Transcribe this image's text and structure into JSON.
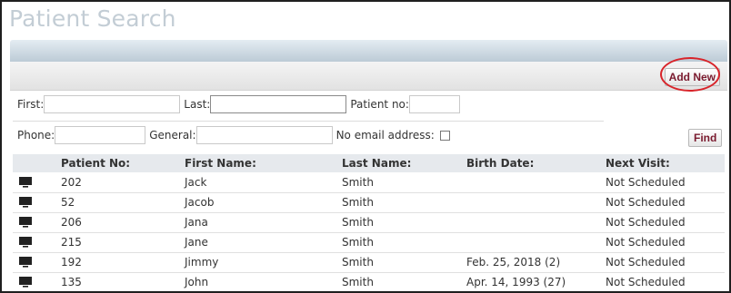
{
  "page": {
    "title": "Patient Search"
  },
  "toolbar": {
    "add_new_label": "Add New",
    "find_label": "Find"
  },
  "filters": {
    "first_label": "First:",
    "last_label": "Last:",
    "patient_no_label": "Patient no:",
    "phone_label": "Phone:",
    "general_label": "General:",
    "no_email_label": "No email address:"
  },
  "table": {
    "headers": [
      "Patient No:",
      "First Name:",
      "Last Name:",
      "Birth Date:",
      "Next Visit:"
    ],
    "rows": [
      {
        "patient_no": "202",
        "first": "Jack",
        "last": "Smith",
        "birth": "",
        "next_visit": "Not Scheduled"
      },
      {
        "patient_no": "52",
        "first": "Jacob",
        "last": "Smith",
        "birth": "",
        "next_visit": "Not Scheduled"
      },
      {
        "patient_no": "206",
        "first": "Jana",
        "last": "Smith",
        "birth": "",
        "next_visit": "Not Scheduled"
      },
      {
        "patient_no": "215",
        "first": "Jane",
        "last": "Smith",
        "birth": "",
        "next_visit": "Not Scheduled"
      },
      {
        "patient_no": "192",
        "first": "Jimmy",
        "last": "Smith",
        "birth": "Feb. 25, 2018 (2)",
        "next_visit": "Not Scheduled"
      },
      {
        "patient_no": "135",
        "first": "John",
        "last": "Smith",
        "birth": "Apr. 14, 1993 (27)",
        "next_visit": "Not Scheduled"
      }
    ]
  }
}
